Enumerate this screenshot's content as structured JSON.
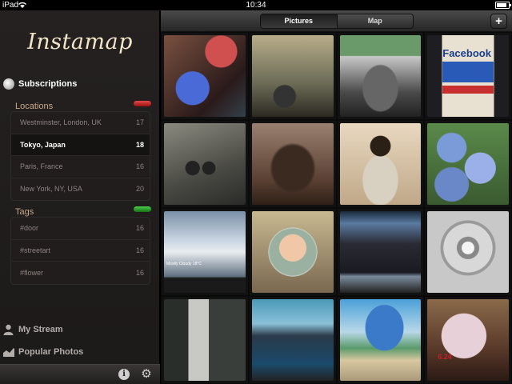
{
  "status_bar": {
    "carrier": "iPad",
    "time": "10:34",
    "battery_percent_label": "",
    "battery_level": 0.85
  },
  "app": {
    "title": "Instamap"
  },
  "sidebar": {
    "subscriptions_label": "Subscriptions",
    "locations": {
      "label": "Locations",
      "color": "#c82020",
      "items": [
        {
          "name": "Westminster, London, UK",
          "count": "17",
          "selected": false
        },
        {
          "name": "Tokyo, Japan",
          "count": "18",
          "selected": true
        },
        {
          "name": "Paris, France",
          "count": "16",
          "selected": false
        },
        {
          "name": "New York, NY, USA",
          "count": "20",
          "selected": false
        }
      ]
    },
    "tags": {
      "label": "Tags",
      "color": "#2a9a2a",
      "items": [
        {
          "name": "#door",
          "count": "16"
        },
        {
          "name": "#streetart",
          "count": "16"
        },
        {
          "name": "#flower",
          "count": "16"
        }
      ]
    },
    "my_stream_label": "My Stream",
    "popular_photos_label": "Popular Photos"
  },
  "main": {
    "segments": [
      {
        "label": "Pictures",
        "active": true
      },
      {
        "label": "Map",
        "active": false
      }
    ],
    "add_label": "+",
    "photos": [
      {
        "id": "p1"
      },
      {
        "id": "p2"
      },
      {
        "id": "p3"
      },
      {
        "id": "p4",
        "title": "Facebook"
      },
      {
        "id": "p5"
      },
      {
        "id": "p6"
      },
      {
        "id": "p7"
      },
      {
        "id": "p8"
      },
      {
        "id": "p9",
        "caption": "Mostly Cloudy 18°C"
      },
      {
        "id": "p10"
      },
      {
        "id": "p11"
      },
      {
        "id": "p12"
      },
      {
        "id": "p13"
      },
      {
        "id": "p14"
      },
      {
        "id": "p15"
      },
      {
        "id": "p16",
        "date": "6.24"
      }
    ]
  }
}
